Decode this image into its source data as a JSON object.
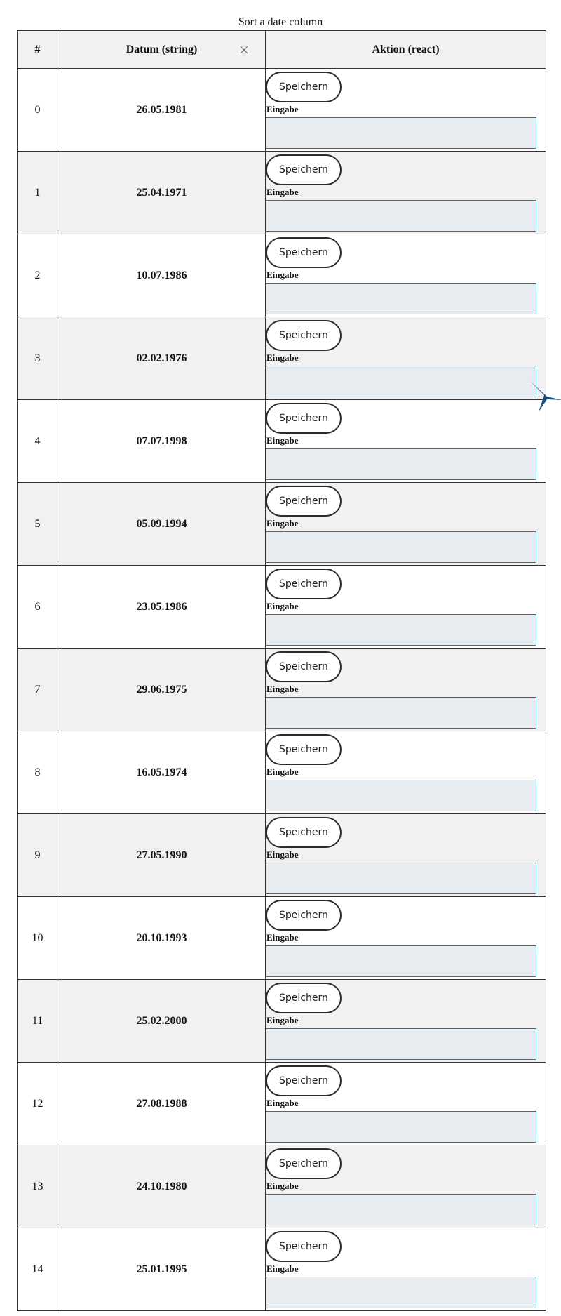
{
  "caption": "Sort a date column",
  "headers": {
    "index": "#",
    "date": "Datum (string)",
    "action": "Aktion (react)"
  },
  "icons": {
    "clear": "close-icon",
    "floating": "bird-icon"
  },
  "colors": {
    "input_border": "#1f7f91",
    "input_bg": "#e6ecf0",
    "row_alt": "#f1f1f1",
    "bird": "#1a4e7e"
  },
  "rows": [
    {
      "index": "0",
      "date": "26.05.1981",
      "button": "Speichern",
      "input_label": "Eingabe",
      "input_value": ""
    },
    {
      "index": "1",
      "date": "25.04.1971",
      "button": "Speichern",
      "input_label": "Eingabe",
      "input_value": ""
    },
    {
      "index": "2",
      "date": "10.07.1986",
      "button": "Speichern",
      "input_label": "Eingabe",
      "input_value": ""
    },
    {
      "index": "3",
      "date": "02.02.1976",
      "button": "Speichern",
      "input_label": "Eingabe",
      "input_value": ""
    },
    {
      "index": "4",
      "date": "07.07.1998",
      "button": "Speichern",
      "input_label": "Eingabe",
      "input_value": ""
    },
    {
      "index": "5",
      "date": "05.09.1994",
      "button": "Speichern",
      "input_label": "Eingabe",
      "input_value": ""
    },
    {
      "index": "6",
      "date": "23.05.1986",
      "button": "Speichern",
      "input_label": "Eingabe",
      "input_value": ""
    },
    {
      "index": "7",
      "date": "29.06.1975",
      "button": "Speichern",
      "input_label": "Eingabe",
      "input_value": ""
    },
    {
      "index": "8",
      "date": "16.05.1974",
      "button": "Speichern",
      "input_label": "Eingabe",
      "input_value": ""
    },
    {
      "index": "9",
      "date": "27.05.1990",
      "button": "Speichern",
      "input_label": "Eingabe",
      "input_value": ""
    },
    {
      "index": "10",
      "date": "20.10.1993",
      "button": "Speichern",
      "input_label": "Eingabe",
      "input_value": ""
    },
    {
      "index": "11",
      "date": "25.02.2000",
      "button": "Speichern",
      "input_label": "Eingabe",
      "input_value": ""
    },
    {
      "index": "12",
      "date": "27.08.1988",
      "button": "Speichern",
      "input_label": "Eingabe",
      "input_value": ""
    },
    {
      "index": "13",
      "date": "24.10.1980",
      "button": "Speichern",
      "input_label": "Eingabe",
      "input_value": ""
    },
    {
      "index": "14",
      "date": "25.01.1995",
      "button": "Speichern",
      "input_label": "Eingabe",
      "input_value": ""
    }
  ]
}
